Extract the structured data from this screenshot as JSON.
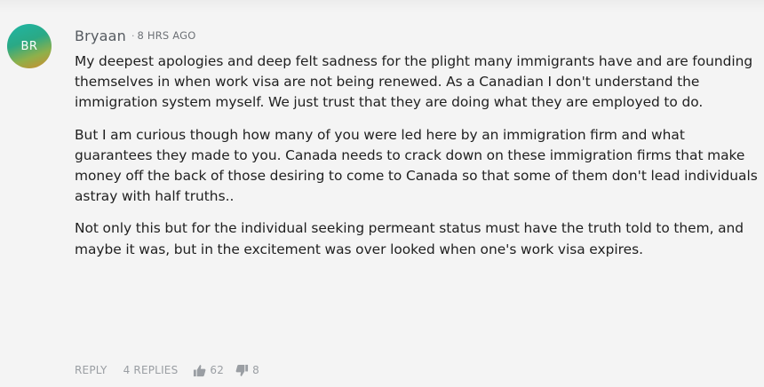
{
  "comment": {
    "avatar_initials": "BR",
    "author": "Bryaan",
    "separator": "·",
    "timestamp": "8 HRS AGO",
    "paragraphs": [
      "My deepest apologies and deep felt sadness for the plight many immigrants have and are founding themselves in when work visa are not being renewed. As a Canadian I don't understand the immigration system myself. We just trust that they are doing what they are employed to do.",
      "But I am curious though how many of you were led here by an immigration firm and what guarantees they made to you. Canada needs to crack down on these immigration firms that make money off the back of those desiring to come to Canada so that some of them don't lead individuals astray with half truths..",
      "Not only this but for the individual seeking permeant status must have the truth told to them, and maybe it was, but in the excitement was over looked when one's work visa expires."
    ],
    "actions": {
      "reply_label": "REPLY",
      "replies_label": "4 REPLIES",
      "upvote_icon": "thumbs-up-icon",
      "upvotes": "62",
      "downvote_icon": "thumbs-down-icon",
      "downvotes": "8"
    }
  },
  "colors": {
    "background": "#f4f4f4",
    "text": "#1f1f1f",
    "muted": "#9a9ea3"
  }
}
